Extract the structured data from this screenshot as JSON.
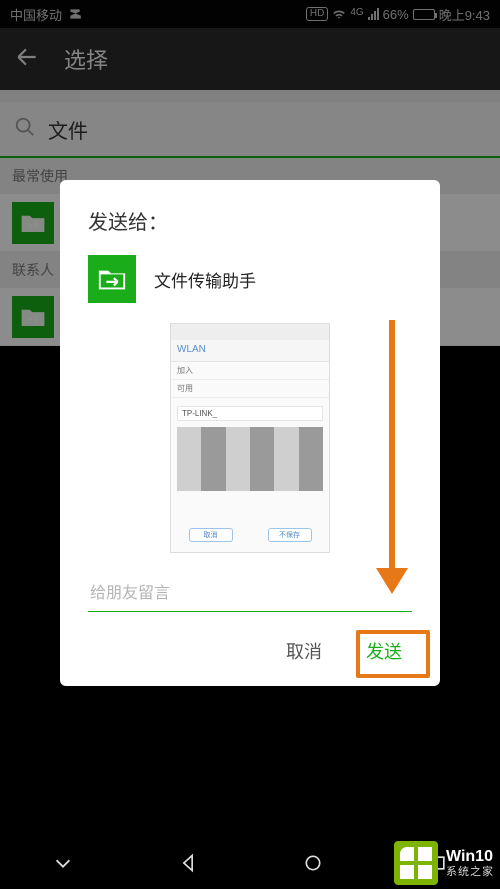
{
  "status": {
    "carrier": "中国移动",
    "hd": "HD",
    "net": "4G",
    "battery_pct": "66%",
    "time": "晚上9:43"
  },
  "header": {
    "title": "选择"
  },
  "search": {
    "text": "文件"
  },
  "sections": {
    "frequent": "最常使用",
    "contacts": "联系人"
  },
  "dialog": {
    "title": "发送给：",
    "recipient": "文件传输助手",
    "placeholder": "给朋友留言",
    "cancel": "取消",
    "send": "发送"
  },
  "thumb": {
    "bar_title": "WLAN",
    "row1": "加入",
    "row2": "可用",
    "chip": "TP-LINK_",
    "btn_left": "取消",
    "btn_right": "不保存"
  },
  "watermark": {
    "line1": "Win10",
    "line2": "系统之家"
  }
}
